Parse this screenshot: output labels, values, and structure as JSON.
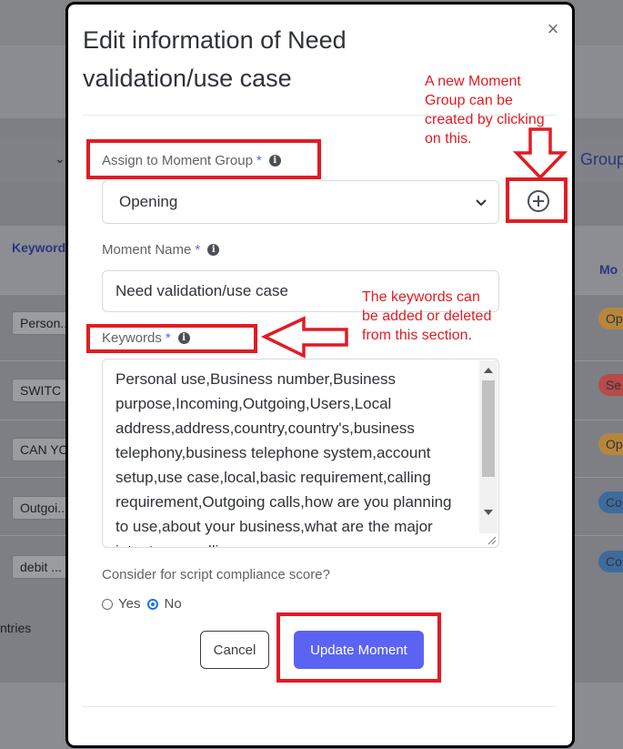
{
  "background": {
    "group_header": "Group",
    "keyword_header": "Keyword",
    "moment_header": "Mo",
    "chips": [
      "Person...",
      "SWITC",
      "CAN YO",
      "Outgoi...",
      "debit ..."
    ],
    "pills": [
      {
        "label": "Op",
        "color": "#b7863d"
      },
      {
        "label": "Se",
        "color": "#b74a4a"
      },
      {
        "label": "Op",
        "color": "#b7863d"
      },
      {
        "label": "Co",
        "color": "#3e6b9e"
      },
      {
        "label": "Co",
        "color": "#3e6b9e"
      }
    ],
    "entries_text": "ntries"
  },
  "modal": {
    "title": "Edit information of Need validation/use case",
    "close_symbol": "×",
    "group_label": "Assign to Moment Group",
    "group_value": "Opening",
    "name_label": "Moment Name",
    "name_value": "Need validation/use case",
    "keywords_label": "Keywords",
    "keywords_value": "Personal use,Business number,Business purpose,Incoming,Outgoing,Users,Local address,address,country,country's,business telephony,business telephone system,account setup,use case,local,basic requirement,calling requirement,Outgoing calls,how are you planning to use,about your business,what are the major intent,your calling",
    "required_mark": "*",
    "info_symbol": "i",
    "compliance_question": "Consider for script compliance score?",
    "yes_label": "Yes",
    "no_label": "No",
    "compliance_selected": "No",
    "cancel_label": "Cancel",
    "update_label": "Update Moment",
    "accent_color": "#5a63f2"
  },
  "annotations": {
    "new_group_note": [
      "A new Moment",
      "Group can be",
      "created by clicking",
      "on this."
    ],
    "keywords_note": [
      "The keywords can",
      "be added or deleted",
      "from this section."
    ],
    "color": "#e21b23"
  }
}
